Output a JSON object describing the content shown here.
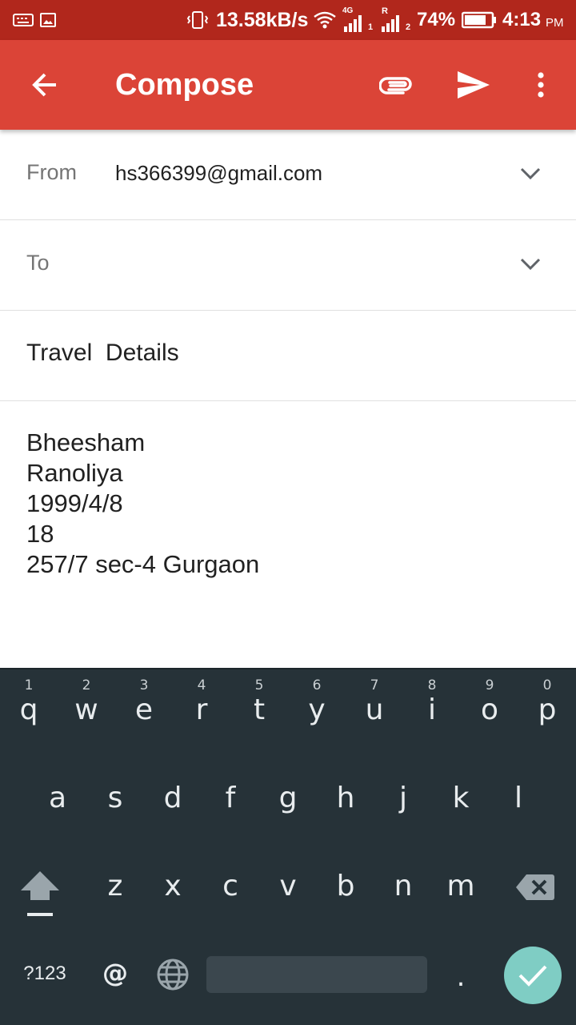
{
  "status_bar": {
    "network_speed": "13.58kB/s",
    "sim1_tech": "4G",
    "sim1_slot": "1",
    "sim2_roaming": "R",
    "sim2_slot": "2",
    "battery": "74%",
    "time": "4:13",
    "ampm": "PM"
  },
  "appbar": {
    "title": "Compose",
    "background_color": "#db4437",
    "back_icon": "arrow-left-icon",
    "attach_icon": "paperclip-icon",
    "send_icon": "send-icon",
    "menu_icon": "more-vert-icon"
  },
  "compose": {
    "from_label": "From",
    "from_value": "hs366399@gmail.com",
    "to_label": "To",
    "to_value": "",
    "subject": "Travel  Details",
    "body_lines": [
      "Bheesham",
      "Ranoliya",
      "1999/4/8",
      "18",
      "257/7 sec-4 Gurgaon"
    ]
  },
  "keyboard": {
    "row1": [
      {
        "ch": "q",
        "hint": "1"
      },
      {
        "ch": "w",
        "hint": "2"
      },
      {
        "ch": "e",
        "hint": "3"
      },
      {
        "ch": "r",
        "hint": "4"
      },
      {
        "ch": "t",
        "hint": "5"
      },
      {
        "ch": "y",
        "hint": "6"
      },
      {
        "ch": "u",
        "hint": "7"
      },
      {
        "ch": "i",
        "hint": "8"
      },
      {
        "ch": "o",
        "hint": "9"
      },
      {
        "ch": "p",
        "hint": "0"
      }
    ],
    "row2": [
      "a",
      "s",
      "d",
      "f",
      "g",
      "h",
      "j",
      "k",
      "l"
    ],
    "row3": [
      "z",
      "x",
      "c",
      "v",
      "b",
      "n",
      "m"
    ],
    "symbols_label": "?123",
    "at_label": "@",
    "period_label": ".",
    "done_color": "#7fcdc4",
    "background_color": "#263238"
  }
}
